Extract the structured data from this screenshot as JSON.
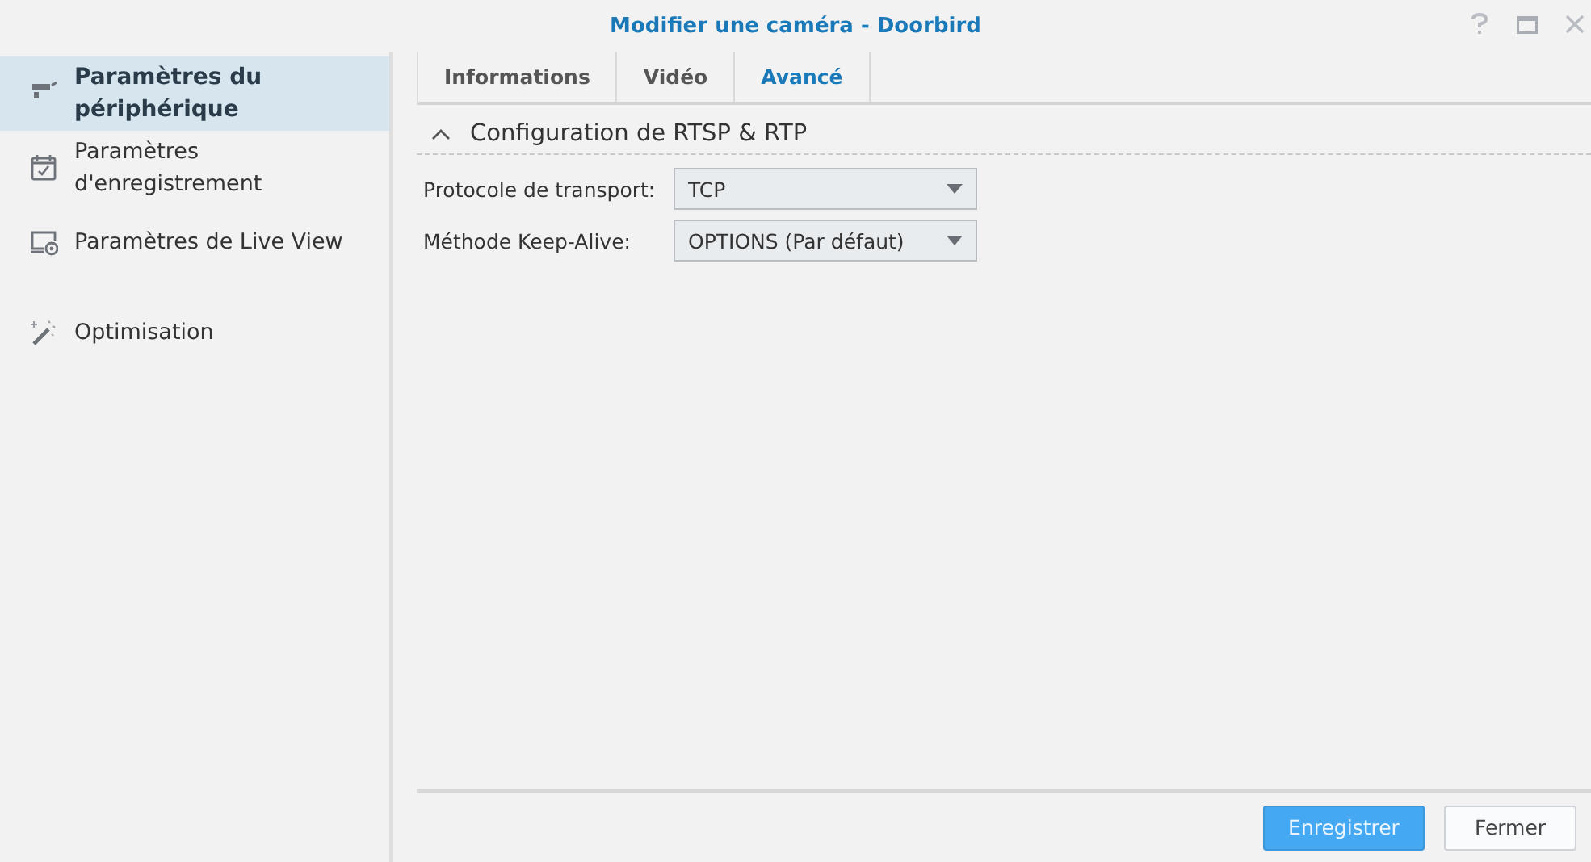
{
  "window": {
    "title": "Modifier une caméra - Doorbird"
  },
  "sidebar": {
    "items": [
      {
        "label": "Paramètres du périphérique",
        "selected": true
      },
      {
        "label": "Paramètres d'enregistrement",
        "selected": false
      },
      {
        "label": "Paramètres de Live View",
        "selected": false
      },
      {
        "label": "Optimisation",
        "selected": false
      }
    ]
  },
  "tabs": [
    {
      "label": "Informations",
      "selected": false
    },
    {
      "label": "Vidéo",
      "selected": false
    },
    {
      "label": "Avancé",
      "selected": true
    }
  ],
  "section": {
    "title": "Configuration de RTSP & RTP",
    "expanded": true,
    "fields": [
      {
        "label": "Protocole de transport:",
        "value": "TCP"
      },
      {
        "label": "Méthode Keep-Alive:",
        "value": "OPTIONS (Par défaut)"
      }
    ]
  },
  "buttons": [
    {
      "label": "Enregistrer",
      "kind": "primary"
    },
    {
      "label": "Fermer",
      "kind": "secondary"
    }
  ]
}
